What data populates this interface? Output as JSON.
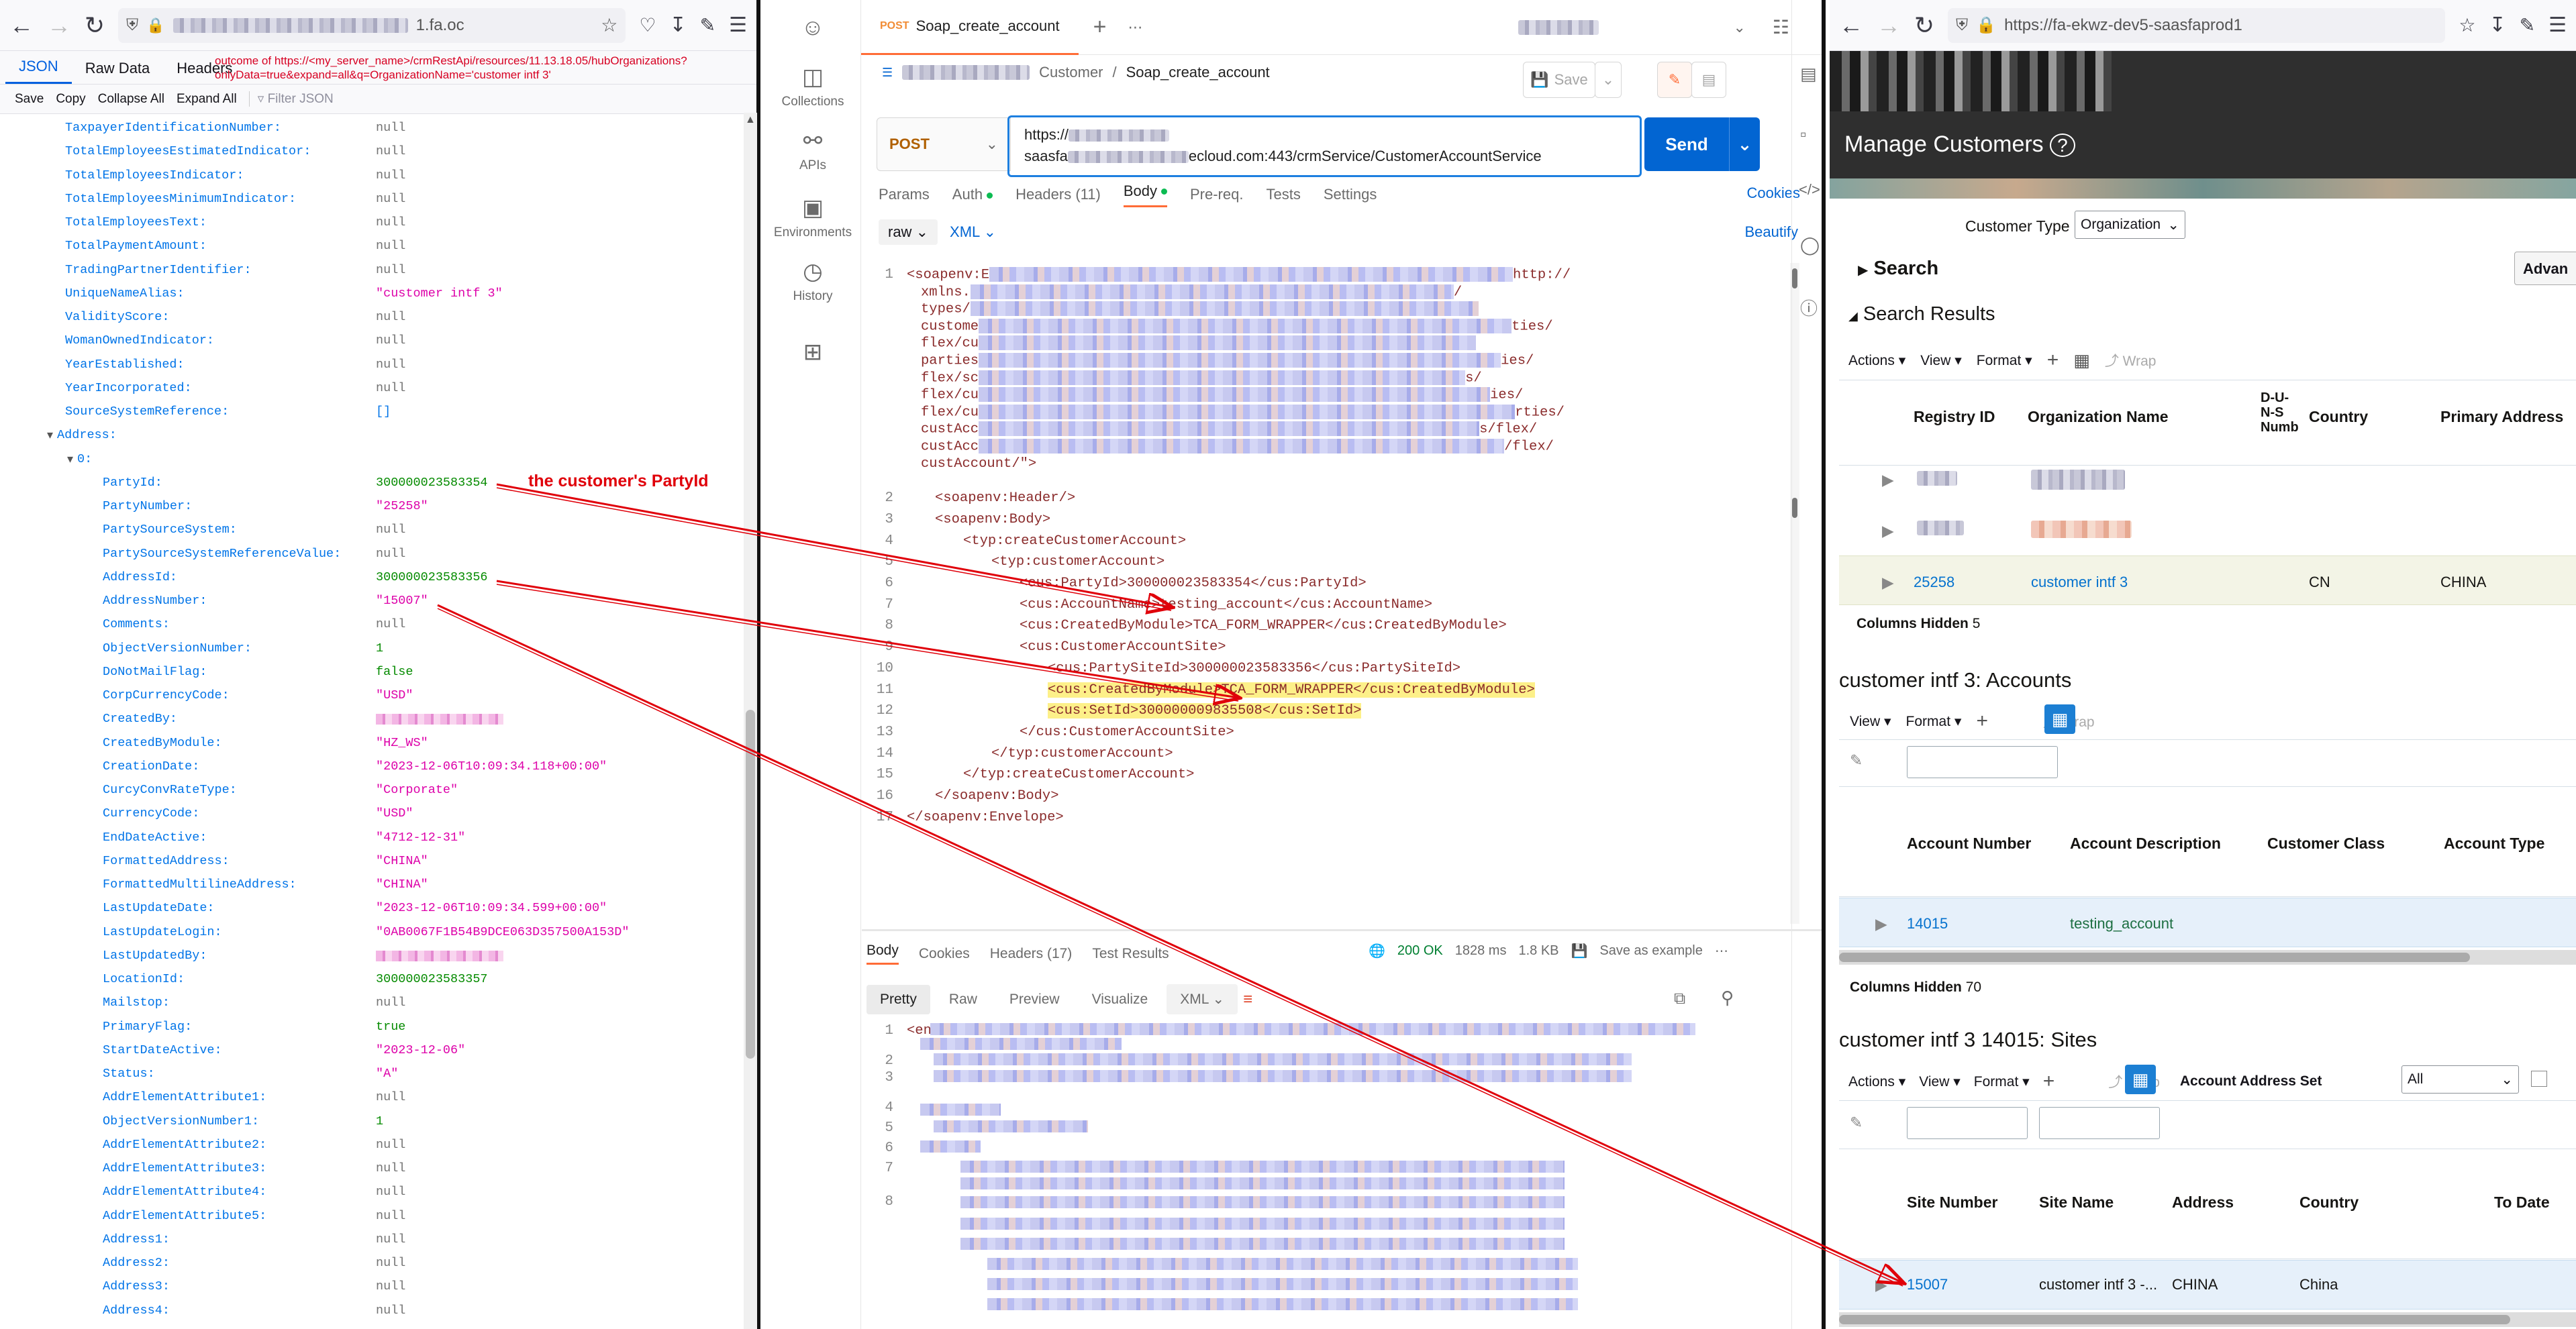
{
  "left": {
    "url_suffix": "1.fa.oc",
    "tabs": [
      "JSON",
      "Raw Data",
      "Headers"
    ],
    "query_note_1": "outcome of https://<my_server_name>/crmRestApi/resources/11.13.18.05/hubOrganizations?",
    "query_note_2": "onlyData=true&expand=all&q=OrganizationName='customer intf 3'",
    "toolbar": [
      "Save",
      "Copy",
      "Collapse All",
      "Expand All"
    ],
    "filter_placeholder": "Filter JSON",
    "rows": [
      {
        "k": "TaxpayerIdentificationNumber:",
        "v": "null",
        "t": "null",
        "d": 0
      },
      {
        "k": "TotalEmployeesEstimatedIndicator:",
        "v": "null",
        "t": "null",
        "d": 0
      },
      {
        "k": "TotalEmployeesIndicator:",
        "v": "null",
        "t": "null",
        "d": 0
      },
      {
        "k": "TotalEmployeesMinimumIndicator:",
        "v": "null",
        "t": "null",
        "d": 0
      },
      {
        "k": "TotalEmployeesText:",
        "v": "null",
        "t": "null",
        "d": 0
      },
      {
        "k": "TotalPaymentAmount:",
        "v": "null",
        "t": "null",
        "d": 0
      },
      {
        "k": "TradingPartnerIdentifier:",
        "v": "null",
        "t": "null",
        "d": 0
      },
      {
        "k": "UniqueNameAlias:",
        "v": "\"customer intf 3\"",
        "t": "str",
        "d": 0
      },
      {
        "k": "ValidityScore:",
        "v": "null",
        "t": "null",
        "d": 0
      },
      {
        "k": "WomanOwnedIndicator:",
        "v": "null",
        "t": "null",
        "d": 0
      },
      {
        "k": "YearEstablished:",
        "v": "null",
        "t": "null",
        "d": 0
      },
      {
        "k": "YearIncorporated:",
        "v": "null",
        "t": "null",
        "d": 0
      },
      {
        "k": "SourceSystemReference:",
        "v": "[]",
        "t": "arr",
        "d": 0
      },
      {
        "k": "Address:",
        "v": "",
        "t": "node",
        "d": -1
      },
      {
        "k": "0:",
        "v": "",
        "t": "node",
        "d": 1
      },
      {
        "k": "PartyId:",
        "v": "300000023583354",
        "t": "num",
        "d": 2
      },
      {
        "k": "PartyNumber:",
        "v": "\"25258\"",
        "t": "str",
        "d": 2
      },
      {
        "k": "PartySourceSystem:",
        "v": "null",
        "t": "null",
        "d": 2
      },
      {
        "k": "PartySourceSystemReferenceValue:",
        "v": "null",
        "t": "null",
        "d": 2
      },
      {
        "k": "AddressId:",
        "v": "300000023583356",
        "t": "num",
        "d": 2
      },
      {
        "k": "AddressNumber:",
        "v": "\"15007\"",
        "t": "str",
        "d": 2
      },
      {
        "k": "Comments:",
        "v": "null",
        "t": "null",
        "d": 2
      },
      {
        "k": "ObjectVersionNumber:",
        "v": "1",
        "t": "num",
        "d": 2
      },
      {
        "k": "DoNotMailFlag:",
        "v": "false",
        "t": "bool",
        "d": 2
      },
      {
        "k": "CorpCurrencyCode:",
        "v": "\"USD\"",
        "t": "str",
        "d": 2
      },
      {
        "k": "CreatedBy:",
        "v": "BLUR",
        "t": "blur",
        "d": 2
      },
      {
        "k": "CreatedByModule:",
        "v": "\"HZ_WS\"",
        "t": "str",
        "d": 2
      },
      {
        "k": "CreationDate:",
        "v": "\"2023-12-06T10:09:34.118+00:00\"",
        "t": "str",
        "d": 2
      },
      {
        "k": "CurcyConvRateType:",
        "v": "\"Corporate\"",
        "t": "str",
        "d": 2
      },
      {
        "k": "CurrencyCode:",
        "v": "\"USD\"",
        "t": "str",
        "d": 2
      },
      {
        "k": "EndDateActive:",
        "v": "\"4712-12-31\"",
        "t": "str",
        "d": 2
      },
      {
        "k": "FormattedAddress:",
        "v": "\"CHINA\"",
        "t": "str",
        "d": 2
      },
      {
        "k": "FormattedMultilineAddress:",
        "v": "\"CHINA\"",
        "t": "str",
        "d": 2
      },
      {
        "k": "LastUpdateDate:",
        "v": "\"2023-12-06T10:09:34.599+00:00\"",
        "t": "str",
        "d": 2
      },
      {
        "k": "LastUpdateLogin:",
        "v": "\"0AB0067F1B54B9DCE063D357500A153D\"",
        "t": "str",
        "d": 2
      },
      {
        "k": "LastUpdatedBy:",
        "v": "BLUR",
        "t": "blur",
        "d": 2
      },
      {
        "k": "LocationId:",
        "v": "300000023583357",
        "t": "num",
        "d": 2
      },
      {
        "k": "Mailstop:",
        "v": "null",
        "t": "null",
        "d": 2
      },
      {
        "k": "PrimaryFlag:",
        "v": "true",
        "t": "bool",
        "d": 2
      },
      {
        "k": "StartDateActive:",
        "v": "\"2023-12-06\"",
        "t": "str",
        "d": 2
      },
      {
        "k": "Status:",
        "v": "\"A\"",
        "t": "str",
        "d": 2
      },
      {
        "k": "AddrElementAttribute1:",
        "v": "null",
        "t": "null",
        "d": 2
      },
      {
        "k": "ObjectVersionNumber1:",
        "v": "1",
        "t": "num",
        "d": 2
      },
      {
        "k": "AddrElementAttribute2:",
        "v": "null",
        "t": "null",
        "d": 2
      },
      {
        "k": "AddrElementAttribute3:",
        "v": "null",
        "t": "null",
        "d": 2
      },
      {
        "k": "AddrElementAttribute4:",
        "v": "null",
        "t": "null",
        "d": 2
      },
      {
        "k": "AddrElementAttribute5:",
        "v": "null",
        "t": "null",
        "d": 2
      },
      {
        "k": "Address1:",
        "v": "null",
        "t": "null",
        "d": 2
      },
      {
        "k": "Address2:",
        "v": "null",
        "t": "null",
        "d": 2
      },
      {
        "k": "Address3:",
        "v": "null",
        "t": "null",
        "d": 2
      },
      {
        "k": "Address4:",
        "v": "null",
        "t": "null",
        "d": 2
      }
    ]
  },
  "annotation": "the customer's PartyId",
  "postman": {
    "sidebar": [
      "Collections",
      "APIs",
      "Environments",
      "History"
    ],
    "tab_method": "POST",
    "tab_name": "Soap_create_account",
    "breadcrumb_parent": "Customer",
    "breadcrumb_sep": "/",
    "request_name": "Soap_create_account",
    "save_label": "Save",
    "method": "POST",
    "url_line1": "https://",
    "url_line2a": "saasfa",
    "url_line2b": "ecloud.com:443/crmService/CustomerAccountService",
    "send_label": "Send",
    "req_tabs": [
      "Params",
      "Auth",
      "Headers (11)",
      "Body",
      "Pre-req.",
      "Tests",
      "Settings"
    ],
    "cookies": "Cookies",
    "body_mode": "raw",
    "body_lang": "XML",
    "beautify": "Beautify",
    "code_line1_head": "<soapenv:E",
    "code_line1_tail": "http://",
    "code_wrap": [
      "xmlns.",
      "types/",
      "custome",
      "flex/cu",
      "parties",
      "flex/sc",
      "flex/cu",
      "flex/cu",
      "custAcc",
      "custAcc",
      "custAccount/\">"
    ],
    "code_wrap_tail": [
      "/",
      "",
      "ties/",
      "",
      "ies/",
      "s/",
      "ies/",
      "rties/",
      "s/flex/",
      "/flex/",
      ""
    ],
    "code": [
      "<soapenv:Header/>",
      "<soapenv:Body>",
      "<typ:createCustomerAccount>",
      "<typ:customerAccount>",
      "<cus:PartyId>300000023583354</cus:PartyId>",
      "<cus:AccountName>testing_account</cus:AccountName>",
      "<cus:CreatedByModule>TCA_FORM_WRAPPER</cus:CreatedByModule>",
      "<cus:CustomerAccountSite>",
      "<cus:PartySiteId>300000023583356</cus:PartySiteId>",
      "<cus:CreatedByModule>TCA_FORM_WRAPPER</cus:CreatedByModule>",
      "<cus:SetId>300000009835508</cus:SetId>",
      "</cus:CustomerAccountSite>",
      "</typ:customerAccount>",
      "</typ:createCustomerAccount>",
      "</soapenv:Body>",
      "</soapenv:Envelope>"
    ],
    "res_tabs": [
      "Body",
      "Cookies",
      "Headers (17)",
      "Test Results"
    ],
    "status": "200 OK",
    "time": "1828 ms",
    "size": "1.8 KB",
    "save_example": "Save as example",
    "view_modes": [
      "Pretty",
      "Raw",
      "Preview",
      "Visualize"
    ],
    "res_lang": "XML",
    "res_first": "<en",
    "res_line_numbers": [
      "1",
      "2",
      "3",
      "4",
      "5",
      "6",
      "7",
      "8"
    ]
  },
  "right": {
    "url": "https://fa-ekwz-dev5-saasfaprod1",
    "page_title": "Manage Customers",
    "customer_type_label": "Customer Type",
    "customer_type_value": "Organization",
    "search_label": "Search",
    "advanced": "Advan",
    "results_label": "Search Results",
    "actions": "Actions",
    "view": "View",
    "format": "Format",
    "wrap": "Wrap",
    "results_cols": [
      "Registry ID",
      "Organization Name",
      "D-U-N-S Numb",
      "Country",
      "Primary Address"
    ],
    "result_row": {
      "registry": "25258",
      "name": "customer intf 3",
      "country": "CN",
      "address": "CHINA"
    },
    "columns_hidden_1": "Columns Hidden",
    "columns_hidden_1_n": "5",
    "accounts_title": "customer intf 3: Accounts",
    "acct_cols": [
      "Account Number",
      "Account Description",
      "Customer Class",
      "Account Type"
    ],
    "acct_row": {
      "number": "14015",
      "desc": "testing_account"
    },
    "columns_hidden_2": "Columns Hidden",
    "columns_hidden_2_n": "70",
    "sites_title": "customer intf 3 14015: Sites",
    "account_address_set_label": "Account Address Set",
    "account_address_set_value": "All",
    "site_cols": [
      "Site Number",
      "Site Name",
      "Address",
      "Country",
      "To Date"
    ],
    "site_row": {
      "number": "15007",
      "name": "customer intf 3 -...",
      "address": "CHINA",
      "country": "China"
    }
  },
  "colors": {
    "accent_postman": "#ff6c37",
    "send": "#0265d2",
    "annot_red": "#e0000a",
    "highlight": "#fdf089"
  }
}
